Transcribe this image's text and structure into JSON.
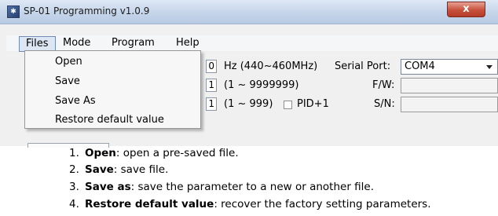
{
  "window": {
    "title": "SP-01 Programming v1.0.9",
    "close_symbol": "x"
  },
  "menubar": [
    "Files",
    "Mode",
    "Program",
    "Help"
  ],
  "dropdown": [
    "Open",
    "Save",
    "Save As",
    "Restore default value"
  ],
  "form": {
    "freq_value": "0",
    "freq_range": "Hz (440~460MHz)",
    "id_value": "1",
    "id_range": "(1 ~ 9999999)",
    "pid_value": "1",
    "pid_range": "(1 ~ 999)",
    "pid_checkbox_label": "PID+1",
    "serial_port_label": "Serial Port:",
    "serial_port_value": "COM4",
    "fw_label": "F/W:",
    "sn_label": "S/N:"
  },
  "steps": [
    {
      "num": "1.",
      "bold": "Open",
      "text": ": open a pre-saved file."
    },
    {
      "num": "2.",
      "bold": "Save",
      "text": ": save file."
    },
    {
      "num": "3.",
      "bold": "Save as",
      "text": ": save the parameter to a new or another file."
    },
    {
      "num": "4.",
      "bold": "Restore default value",
      "text": ": recover the factory setting parameters."
    }
  ],
  "icons": {
    "app": "app-icon",
    "close": "close-icon",
    "dropdown_arrow": "chevron-down-icon"
  }
}
